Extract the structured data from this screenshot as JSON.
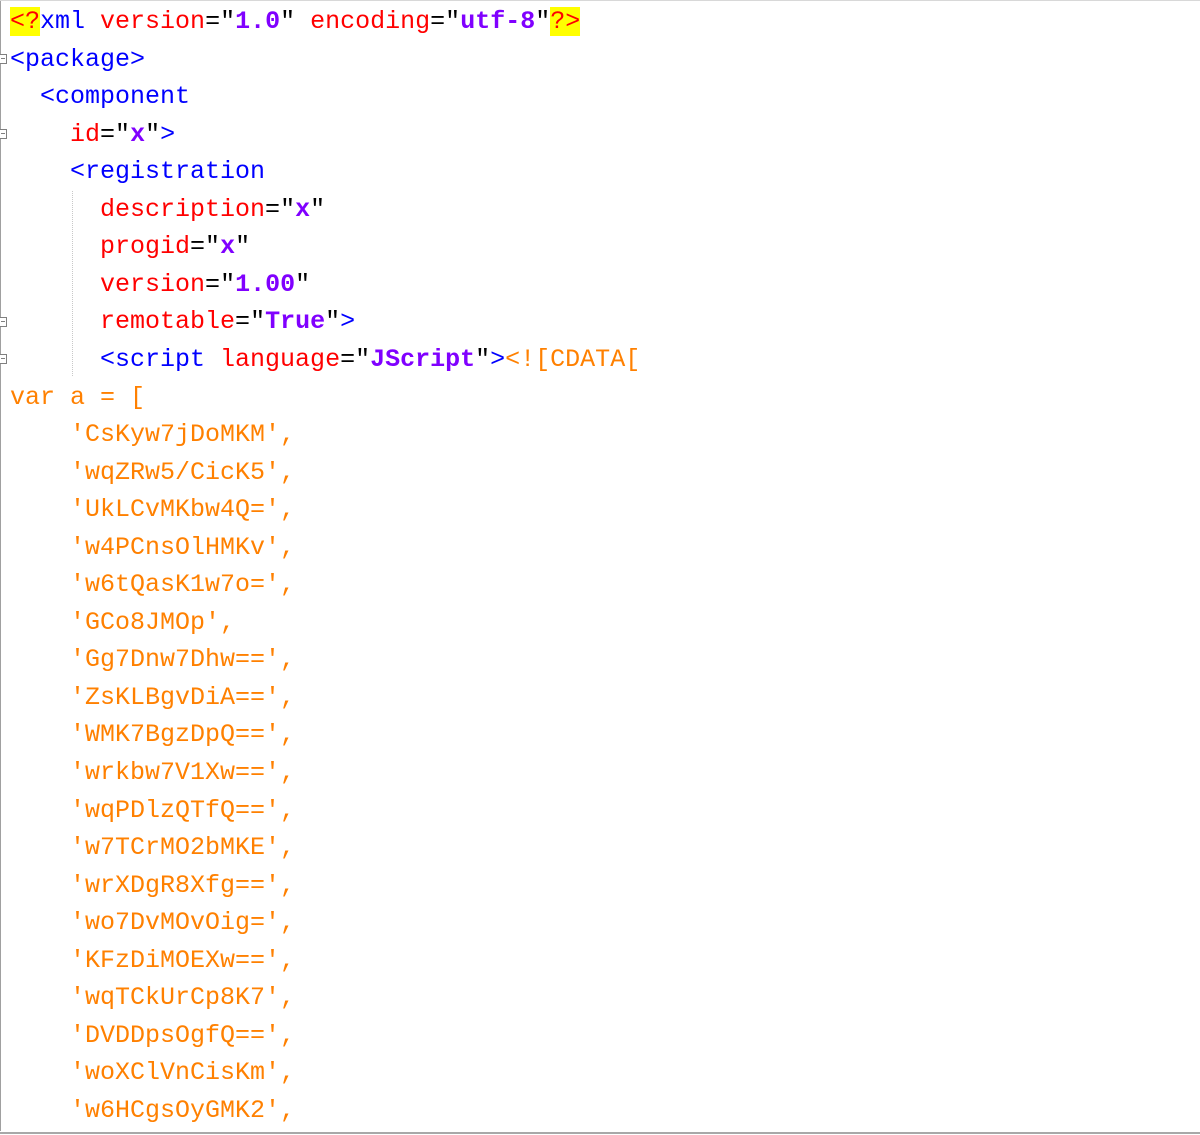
{
  "editor": {
    "lines": [
      {
        "indent": "",
        "parts": [
          {
            "t": "<?",
            "c": "pi hl"
          },
          {
            "t": "xml ",
            "c": "tag"
          },
          {
            "t": "version",
            "c": "attr"
          },
          {
            "t": "=",
            "c": "eq"
          },
          {
            "t": "\"",
            "c": "quote"
          },
          {
            "t": "1.0",
            "c": "val"
          },
          {
            "t": "\" ",
            "c": "quote"
          },
          {
            "t": "encoding",
            "c": "attr"
          },
          {
            "t": "=",
            "c": "eq"
          },
          {
            "t": "\"",
            "c": "quote"
          },
          {
            "t": "utf-8",
            "c": "val"
          },
          {
            "t": "\"",
            "c": "quote"
          },
          {
            "t": "?>",
            "c": "pi hl"
          }
        ]
      },
      {
        "indent": "",
        "parts": [
          {
            "t": "<package>",
            "c": "tag"
          }
        ]
      },
      {
        "indent": "  ",
        "parts": [
          {
            "t": "<component",
            "c": "tag"
          }
        ]
      },
      {
        "indent": "    ",
        "parts": [
          {
            "t": "id",
            "c": "attr"
          },
          {
            "t": "=",
            "c": "eq"
          },
          {
            "t": "\"",
            "c": "quote"
          },
          {
            "t": "x",
            "c": "val"
          },
          {
            "t": "\"",
            "c": "quote"
          },
          {
            "t": ">",
            "c": "tag"
          }
        ]
      },
      {
        "indent": "    ",
        "parts": [
          {
            "t": "<registration",
            "c": "tag"
          }
        ]
      },
      {
        "indent": "      ",
        "parts": [
          {
            "t": "description",
            "c": "attr"
          },
          {
            "t": "=",
            "c": "eq"
          },
          {
            "t": "\"",
            "c": "quote"
          },
          {
            "t": "x",
            "c": "val"
          },
          {
            "t": "\"",
            "c": "quote"
          }
        ]
      },
      {
        "indent": "      ",
        "parts": [
          {
            "t": "progid",
            "c": "attr"
          },
          {
            "t": "=",
            "c": "eq"
          },
          {
            "t": "\"",
            "c": "quote"
          },
          {
            "t": "x",
            "c": "val"
          },
          {
            "t": "\"",
            "c": "quote"
          }
        ]
      },
      {
        "indent": "      ",
        "parts": [
          {
            "t": "version",
            "c": "attr"
          },
          {
            "t": "=",
            "c": "eq"
          },
          {
            "t": "\"",
            "c": "quote"
          },
          {
            "t": "1.00",
            "c": "val"
          },
          {
            "t": "\"",
            "c": "quote"
          }
        ]
      },
      {
        "indent": "      ",
        "parts": [
          {
            "t": "remotable",
            "c": "attr"
          },
          {
            "t": "=",
            "c": "eq"
          },
          {
            "t": "\"",
            "c": "quote"
          },
          {
            "t": "True",
            "c": "val"
          },
          {
            "t": "\"",
            "c": "quote"
          },
          {
            "t": ">",
            "c": "tag"
          }
        ]
      },
      {
        "indent": "      ",
        "parts": [
          {
            "t": "<script ",
            "c": "tag"
          },
          {
            "t": "language",
            "c": "attr"
          },
          {
            "t": "=",
            "c": "eq"
          },
          {
            "t": "\"",
            "c": "quote"
          },
          {
            "t": "JScript",
            "c": "val"
          },
          {
            "t": "\"",
            "c": "quote"
          },
          {
            "t": ">",
            "c": "tag"
          },
          {
            "t": "<![CDATA[",
            "c": "js"
          }
        ]
      },
      {
        "indent": "",
        "parts": [
          {
            "t": "var a = [",
            "c": "js"
          }
        ]
      },
      {
        "indent": "    ",
        "parts": [
          {
            "t": "'CsKyw7jDoMKM',",
            "c": "js"
          }
        ]
      },
      {
        "indent": "    ",
        "parts": [
          {
            "t": "'wqZRw5/CicK5',",
            "c": "js"
          }
        ]
      },
      {
        "indent": "    ",
        "parts": [
          {
            "t": "'UkLCvMKbw4Q=',",
            "c": "js"
          }
        ]
      },
      {
        "indent": "    ",
        "parts": [
          {
            "t": "'w4PCnsOlHMKv',",
            "c": "js"
          }
        ]
      },
      {
        "indent": "    ",
        "parts": [
          {
            "t": "'w6tQasK1w7o=',",
            "c": "js"
          }
        ]
      },
      {
        "indent": "    ",
        "parts": [
          {
            "t": "'GCo8JMOp',",
            "c": "js"
          }
        ]
      },
      {
        "indent": "    ",
        "parts": [
          {
            "t": "'Gg7Dnw7Dhw==',",
            "c": "js"
          }
        ]
      },
      {
        "indent": "    ",
        "parts": [
          {
            "t": "'ZsKLBgvDiA==',",
            "c": "js"
          }
        ]
      },
      {
        "indent": "    ",
        "parts": [
          {
            "t": "'WMK7BgzDpQ==',",
            "c": "js"
          }
        ]
      },
      {
        "indent": "    ",
        "parts": [
          {
            "t": "'wrkbw7V1Xw==',",
            "c": "js"
          }
        ]
      },
      {
        "indent": "    ",
        "parts": [
          {
            "t": "'wqPDlzQTfQ==',",
            "c": "js"
          }
        ]
      },
      {
        "indent": "    ",
        "parts": [
          {
            "t": "'w7TCrMO2bMKE',",
            "c": "js"
          }
        ]
      },
      {
        "indent": "    ",
        "parts": [
          {
            "t": "'wrXDgR8Xfg==',",
            "c": "js"
          }
        ]
      },
      {
        "indent": "    ",
        "parts": [
          {
            "t": "'wo7DvMOvOig=',",
            "c": "js"
          }
        ]
      },
      {
        "indent": "    ",
        "parts": [
          {
            "t": "'KFzDiMOEXw==',",
            "c": "js"
          }
        ]
      },
      {
        "indent": "    ",
        "parts": [
          {
            "t": "'wqTCkUrCp8K7',",
            "c": "js"
          }
        ]
      },
      {
        "indent": "    ",
        "parts": [
          {
            "t": "'DVDDpsOgfQ==',",
            "c": "js"
          }
        ]
      },
      {
        "indent": "    ",
        "parts": [
          {
            "t": "'woXClVnCisKm',",
            "c": "js"
          }
        ]
      },
      {
        "indent": "    ",
        "parts": [
          {
            "t": "'w6HCgsOyGMK2',",
            "c": "js"
          }
        ]
      }
    ]
  }
}
